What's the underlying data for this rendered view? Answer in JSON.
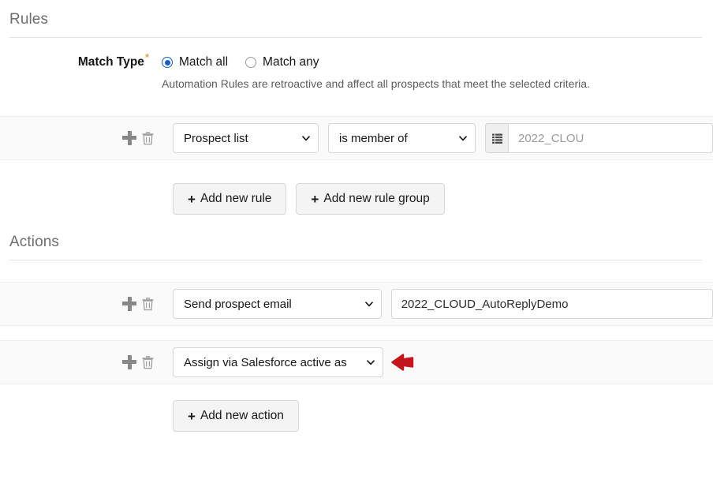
{
  "rules_section": {
    "heading": "Rules",
    "match_type": {
      "label": "Match Type",
      "required_marker": "*",
      "options": [
        {
          "label": "Match all",
          "selected": true
        },
        {
          "label": "Match any",
          "selected": false
        }
      ],
      "helper_text": "Automation Rules are retroactive and affect all prospects that meet the selected criteria."
    },
    "criteria_rows": [
      {
        "field": "Prospect list",
        "operator": "is member of",
        "value": "2022_CLOU",
        "list_picker_icon": "list-icon",
        "add_icon": "plus-icon",
        "delete_icon": "trash-icon"
      }
    ],
    "buttons": [
      {
        "plus": "+",
        "label": "Add new rule"
      },
      {
        "plus": "+",
        "label": "Add new rule group"
      }
    ]
  },
  "actions_section": {
    "heading": "Actions",
    "action_rows": [
      {
        "action": "Send prospect email",
        "value": "2022_CLOUD_AutoReplyDemo",
        "add_icon": "plus-icon",
        "delete_icon": "trash-icon",
        "has_annotation": false
      },
      {
        "action": "Assign via Salesforce active as",
        "value": "",
        "add_icon": "plus-icon",
        "delete_icon": "trash-icon",
        "has_annotation": true,
        "annotation_icon": "red-left-arrow-icon"
      }
    ],
    "buttons": [
      {
        "plus": "+",
        "label": "Add new action"
      }
    ]
  },
  "colors": {
    "accent_blue": "#0b5cd5",
    "required_orange": "#e8a33d",
    "annotation_red": "#c4161c",
    "row_background": "#fafafa",
    "heading_gray": "#6e6e6e"
  }
}
